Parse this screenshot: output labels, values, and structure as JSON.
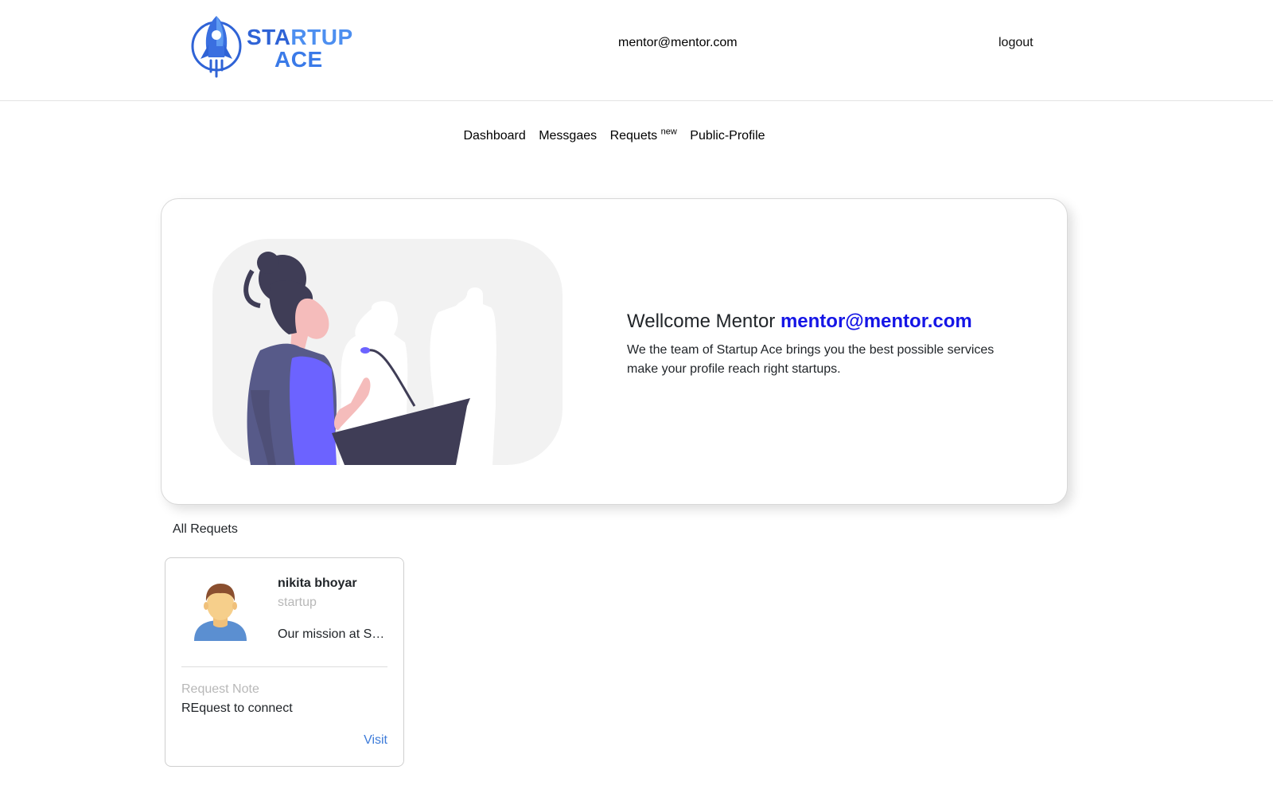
{
  "header": {
    "logo_line1_a": "STA",
    "logo_line1_b": "RTUP",
    "logo_line2": "ACE",
    "user_email": "mentor@mentor.com",
    "logout_label": "logout"
  },
  "nav": {
    "items": [
      {
        "label": "Dashboard"
      },
      {
        "label": "Messgaes"
      },
      {
        "label": "Requets",
        "badge": "new"
      },
      {
        "label": "Public-Profile"
      }
    ]
  },
  "welcome": {
    "greeting": "Wellcome Mentor",
    "email": "mentor@mentor.com",
    "description": "We the team of Startup Ace brings you the best possible services make your profile reach right startups."
  },
  "requests": {
    "section_title": "All Requets",
    "items": [
      {
        "name": "nikita bhoyar",
        "type": "startup",
        "mission": "Our mission at S…",
        "note_label": "Request Note",
        "note": "REquest to connect",
        "visit_label": "Visit"
      }
    ]
  },
  "colors": {
    "accent_email": "#1515e6",
    "logo_blue": "#2f63d6",
    "link_blue": "#3d7bd9",
    "muted_text": "#b8b8b8",
    "illustration_purple": "#6c63ff",
    "illustration_dark": "#3f3d56"
  }
}
